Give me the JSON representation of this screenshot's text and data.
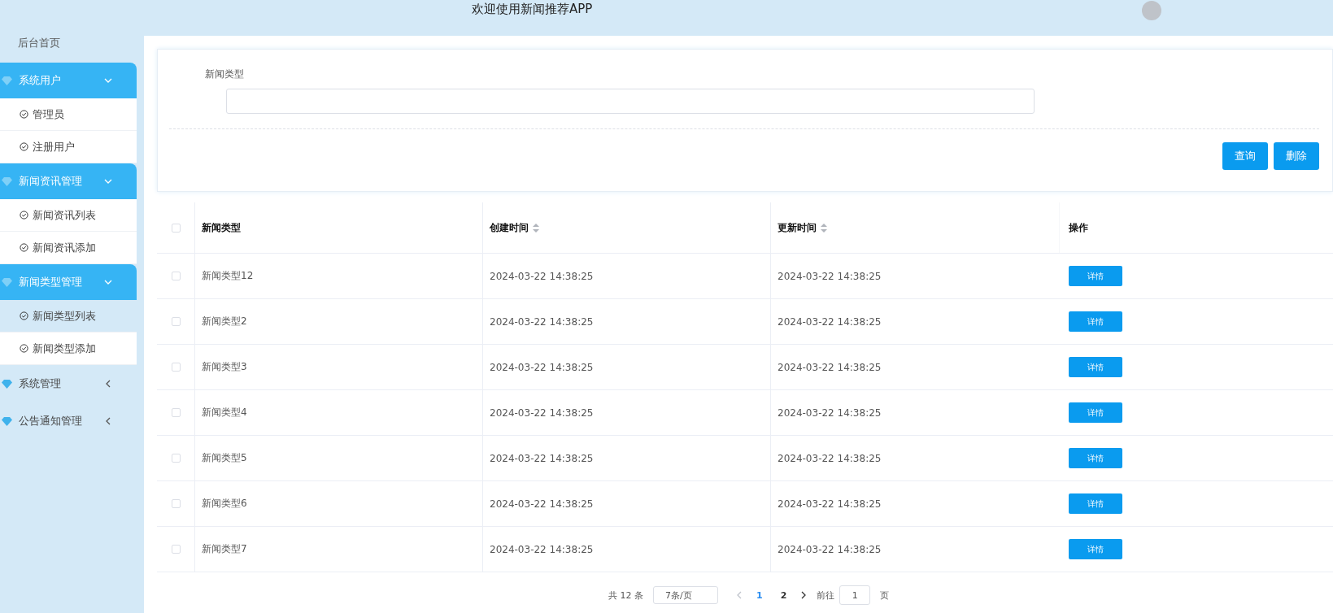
{
  "header": {
    "title": "欢迎使用新闻推荐APP"
  },
  "sidebar": {
    "items": [
      {
        "kind": "link",
        "label": "后台首页"
      },
      {
        "kind": "group",
        "label": "系统用户",
        "expanded": true,
        "children": [
          {
            "label": "管理员",
            "selected": false
          },
          {
            "label": "注册用户",
            "selected": false
          }
        ]
      },
      {
        "kind": "group",
        "label": "新闻资讯管理",
        "expanded": true,
        "children": [
          {
            "label": "新闻资讯列表",
            "selected": false
          },
          {
            "label": "新闻资讯添加",
            "selected": false
          }
        ]
      },
      {
        "kind": "group",
        "label": "新闻类型管理",
        "expanded": true,
        "children": [
          {
            "label": "新闻类型列表",
            "selected": true
          },
          {
            "label": "新闻类型添加",
            "selected": false
          }
        ]
      },
      {
        "kind": "group",
        "label": "系统管理",
        "expanded": false
      },
      {
        "kind": "group",
        "label": "公告通知管理",
        "expanded": false
      }
    ]
  },
  "search": {
    "label": "新闻类型",
    "buttons": [
      "查询",
      "删除"
    ]
  },
  "table": {
    "all_checked": false,
    "columns": [
      {
        "label": "新闻类型",
        "sortable": false
      },
      {
        "label": "创建时间",
        "sortable": true
      },
      {
        "label": "更新时间",
        "sortable": true
      },
      {
        "label": "操作",
        "sortable": false
      }
    ],
    "rows": [
      {
        "checked": false,
        "cells": [
          "新闻类型12",
          "2024-03-22 14:38:25",
          "2024-03-22 14:38:25"
        ],
        "action": "详情"
      },
      {
        "checked": false,
        "cells": [
          "新闻类型2",
          "2024-03-22 14:38:25",
          "2024-03-22 14:38:25"
        ],
        "action": "详情"
      },
      {
        "checked": false,
        "cells": [
          "新闻类型3",
          "2024-03-22 14:38:25",
          "2024-03-22 14:38:25"
        ],
        "action": "详情"
      },
      {
        "checked": false,
        "cells": [
          "新闻类型4",
          "2024-03-22 14:38:25",
          "2024-03-22 14:38:25"
        ],
        "action": "详情"
      },
      {
        "checked": false,
        "cells": [
          "新闻类型5",
          "2024-03-22 14:38:25",
          "2024-03-22 14:38:25"
        ],
        "action": "详情"
      },
      {
        "checked": false,
        "cells": [
          "新闻类型6",
          "2024-03-22 14:38:25",
          "2024-03-22 14:38:25"
        ],
        "action": "详情"
      },
      {
        "checked": false,
        "cells": [
          "新闻类型7",
          "2024-03-22 14:38:25",
          "2024-03-22 14:38:25"
        ],
        "action": "详情"
      }
    ]
  },
  "pagination": {
    "total": "共 12 条",
    "page_size": "7条/页",
    "pages": [
      {
        "label": "1",
        "selected": true
      },
      {
        "label": "2",
        "selected": false
      }
    ],
    "jump_label": "前往",
    "jump_value": "1",
    "jump_suffix": "页"
  }
}
